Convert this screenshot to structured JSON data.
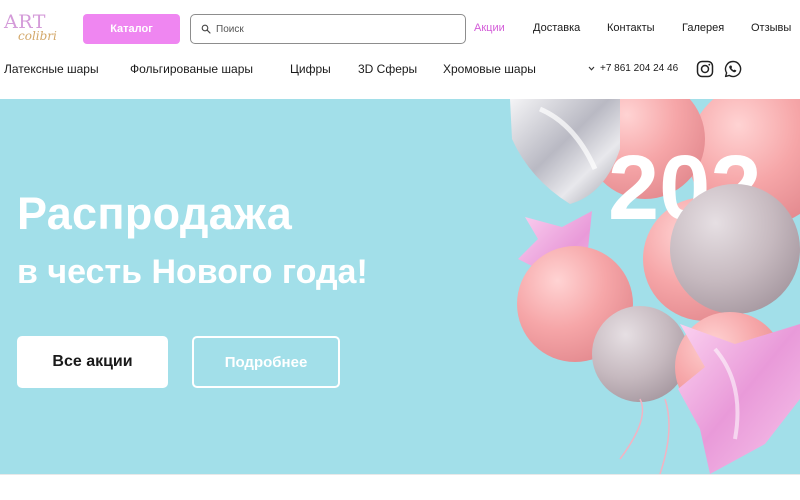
{
  "brand": {
    "line1": "ART",
    "line2": "colibri"
  },
  "header": {
    "catalog_label": "Каталог",
    "search_placeholder": "Поиск",
    "nav": [
      {
        "label": "Акции",
        "active": true
      },
      {
        "label": "Доставка",
        "active": false
      },
      {
        "label": "Контакты",
        "active": false
      },
      {
        "label": "Галерея",
        "active": false
      },
      {
        "label": "Отзывы",
        "active": false
      }
    ]
  },
  "categories": [
    "Латексные шары",
    "Фольгированые шары",
    "Цифры",
    "3D Сферы",
    "Хромовые шары"
  ],
  "contacts": {
    "phone": "+7 861 204 24 46",
    "icons": [
      "chevron-down-icon",
      "instagram-icon",
      "whatsapp-icon"
    ]
  },
  "hero": {
    "title": "Распродажа",
    "subtitle": "в честь Нового года!",
    "primary_button": "Все акции",
    "secondary_button": "Подробнее",
    "year_text": "202"
  },
  "colors": {
    "accent": "#ef86f1",
    "active_link": "#d35bd8",
    "hero_bg": "#a2dfe9"
  }
}
